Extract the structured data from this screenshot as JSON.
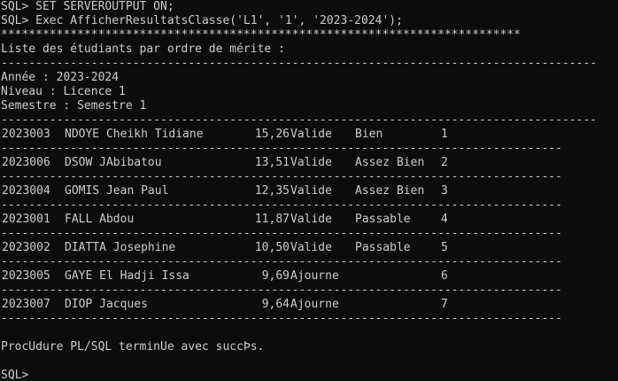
{
  "terminal": {
    "cmd1": "SQL> SET SERVEROUTPUT ON;",
    "cmd2": "SQL> Exec AfficherResultatsClasse('L1', '1', '2023-2024');",
    "stars": "***************************************************************************",
    "heading": "Liste des étudiants par ordre de mérite :",
    "dash_long": "--------------------------------------------------------------------------------------",
    "dash_row": "---------------------------------------------------------------------------------",
    "annee": "Année : 2023-2024",
    "niveau": "Niveau : Licence 1",
    "semestre": "Semestre : Semestre 1",
    "rows": [
      {
        "id": "2023003",
        "name": "NDOYE Cheikh Tidiane",
        "score": "15,26",
        "decision": "Valide",
        "mention": "Bien",
        "rank": "1"
      },
      {
        "id": "2023006",
        "name": "DSOW JAbibatou",
        "score": "13,51",
        "decision": "Valide",
        "mention": "Assez Bien",
        "rank": "2"
      },
      {
        "id": "2023004",
        "name": "GOMIS Jean Paul",
        "score": "12,35",
        "decision": "Valide",
        "mention": "Assez Bien",
        "rank": "3"
      },
      {
        "id": "2023001",
        "name": "FALL Abdou",
        "score": "11,87",
        "decision": "Valide",
        "mention": "Passable",
        "rank": "4"
      },
      {
        "id": "2023002",
        "name": "DIATTA Josephine",
        "score": "10,50",
        "decision": "Valide",
        "mention": "Passable",
        "rank": "5"
      },
      {
        "id": "2023005",
        "name": "GAYE El Hadji Issa",
        "score": "9,69",
        "decision": "Ajourne",
        "mention": "",
        "rank": "6"
      },
      {
        "id": "2023007",
        "name": "DIOP Jacques",
        "score": "9,64",
        "decision": "Ajourne",
        "mention": "",
        "rank": "7"
      }
    ],
    "done": "ProcÚdure PL/SQL terminÚe avec succÞs.",
    "prompt": "SQL>"
  }
}
